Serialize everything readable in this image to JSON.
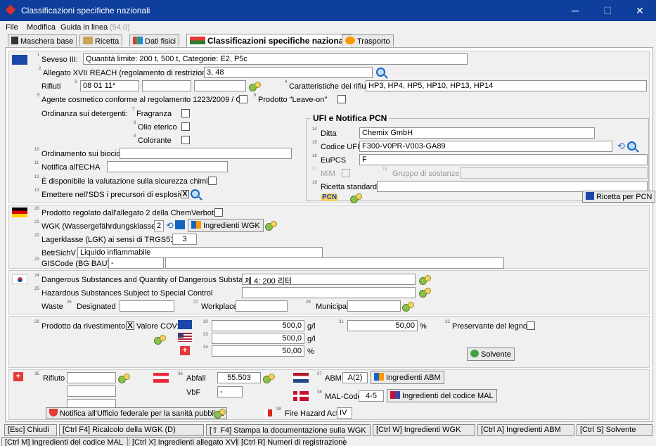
{
  "window": {
    "title": "Classificazioni specifiche nazionali",
    "minimize": "─",
    "maximize": "☐",
    "close": "✕"
  },
  "menu": {
    "file": "File",
    "edit": "Modifica",
    "help": "Guida in linea",
    "version": "(54.0)"
  },
  "tabs": [
    {
      "label": "Maschera base"
    },
    {
      "label": "Ricetta"
    },
    {
      "label": "Dati fisici"
    },
    {
      "label": "Classificazioni specifiche nazionali"
    },
    {
      "label": "Trasporto"
    }
  ],
  "eu": {
    "seveso_label": "Seveso III:",
    "seveso_value": "Quantità limite: 200 t, 500 t, Categorie: E2, P5c",
    "reach_label": "Allegato XVII REACH (regolamento di restrizione):",
    "reach_value": "3, 48",
    "rifiuti_label": "Rifiuti",
    "rifiuti_value": "08 01 11*",
    "caratt_label": "Caratteristiche dei rifiuti",
    "caratt_value": "HP3, HP4, HP5, HP10, HP13, HP14",
    "cosm_label": "Agente cosmetico conforme al regolamento 1223/2009 / CE",
    "leave_on_label": "Prodotto \"Leave-on\"",
    "deterg_label": "Ordinanza sui detergenti:",
    "fragranza": "Fragranza",
    "olio": "Olio eterico",
    "colorante": "Colorante",
    "biocidi_label": "Ordinamento sui biocidi",
    "echa_label": "Notifica all'ECHA",
    "sicurezza_label": "È disponibile la valutazione sulla sicurezza chimica",
    "esplosivi_label": "Emettere nell'SDS i precursori di esplosivi",
    "esplosivi_checked": "X"
  },
  "ufi": {
    "group_title": "UFI e Notifica PCN",
    "ditta_label": "Ditta",
    "ditta_value": "Chemix GmbH",
    "codice_label": "Codice UFI",
    "codice_value": "F300-V0PR-V003-GA89",
    "eupcs_label": "EuPCS",
    "eupcs_value": "F",
    "mim_label": "MiM",
    "gruppo_label": "Gruppo di sostanze",
    "ricetta_label": "Ricetta standard",
    "pcn_logo": "PCN",
    "ricetta_pcn_button": "Ricetta per PCN"
  },
  "de": {
    "chemverbots_label": "Prodotto regolato dall'allegato 2 della ChemVerbotsV",
    "wgk_label": "WGK (Wassergefährdungsklasse)",
    "wgk_value": "2",
    "wgk_button": "Ingredienti WGK",
    "lgk_label": "Lagerklasse (LGK) ai sensi di TRGS510",
    "lgk_value": "3",
    "betrsichv_label": "BetrSichV",
    "betrsichv_value": "Liquido infiammabile",
    "giscode_label": "GISCode (BG BAU)",
    "giscode_value": "-"
  },
  "kr": {
    "dangerous_label": "Dangerous Substances and Quantity of Dangerous Substances",
    "dangerous_value": "제 4: 200 리터",
    "special_label": "Hazardous Substances Subject to Special Control",
    "waste_label": "Waste",
    "designated_label": "Designated",
    "workplace_label": "Workplace",
    "municipal_label": "Municipal"
  },
  "voc": {
    "rivest_label": "Prodotto da rivestimento",
    "rivest_checked": "X",
    "cov_label": "Valore COV:",
    "eu_value": "500,0",
    "eu_unit": "g/l",
    "right_value": "50,00",
    "right_unit": "%",
    "legno_label": "Preservante del legno",
    "us_value": "500,0",
    "us_unit": "g/l",
    "ch_value": "50,00",
    "ch_unit": "%",
    "solvente_button": "Solvente"
  },
  "ch": {
    "rifiuto_label": "Rifiuto",
    "abfall_label": "Abfall",
    "abfall_value": "55.503",
    "vbf_label": "VbF",
    "vbf_value": "-",
    "abm_label": "ABM",
    "abm_value": "A(2)",
    "abm_button": "Ingredienti ABM",
    "mal_label": "MAL-Code",
    "mal_value": "4-5",
    "mal_button": "Ingredienti del codice MAL",
    "notifica_button": "Notifica all'Ufficio federale per la sanità pubblica",
    "fire_label": "Fire Hazard Act",
    "fire_value": "IV"
  },
  "sup": {
    "s1": "1",
    "s2": "2",
    "s3": "3",
    "s4": "4",
    "s5": "5",
    "s6": "6",
    "s7": "7",
    "s8": "8",
    "s9": "9",
    "s10": "10",
    "s11": "11",
    "s12": "12",
    "s13": "13",
    "s14": "14",
    "s15": "15",
    "s16": "16",
    "s17": "17",
    "s18": "18",
    "s19": "19",
    "s20": "20",
    "s21": "21",
    "s22": "22",
    "s23": "23",
    "s24": "24",
    "s25": "25",
    "s26": "26",
    "s27": "27",
    "s28": "28",
    "s29": "29",
    "s30": "30",
    "s31": "31",
    "s32": "32",
    "s33": "33",
    "s34": "34",
    "s35": "35",
    "s36": "36",
    "s37": "37",
    "s38": "38",
    "s39": "39"
  },
  "bottom": {
    "chiudi": "[Esc] Chiudi",
    "ricalcolo": "[Ctrl F4] Ricalcolo della WGK (D)",
    "stampa": "[⇧ F4] Stampa la documentazione sulla WGK",
    "ingr_wgk": "[Ctrl W] Ingredienti WGK",
    "ingr_abm": "[Ctrl A] Ingredienti ABM",
    "solvente": "[Ctrl S] Solvente",
    "ingr_mal": "[Ctrl M] Ingredienti del codice MAL",
    "ingr_xvii": "[Ctrl X] Ingredienti allegato XVII",
    "numeri": "[Ctrl R] Numeri di registrazione"
  }
}
